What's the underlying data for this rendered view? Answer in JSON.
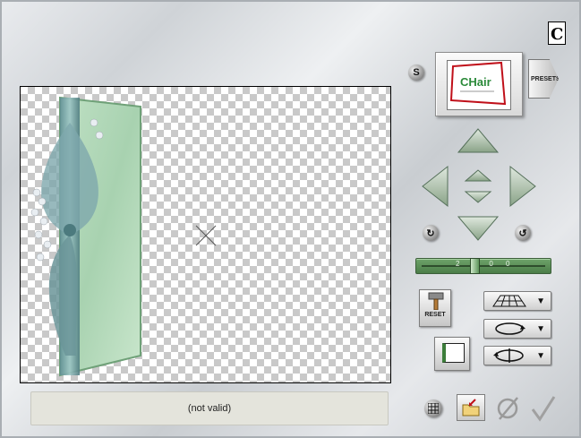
{
  "status": {
    "text": "(not valid)"
  },
  "thumbnail": {
    "caption": "CHair"
  },
  "presets": {
    "label": "PRESETS"
  },
  "s_button": {
    "label": "S"
  },
  "reset": {
    "label": "RESET"
  },
  "slider": {
    "ticks": "2 0 0 0",
    "value_fraction": 0.42
  },
  "icons": {
    "corner": "corel-logo-icon",
    "up": "arrow-up-icon",
    "down": "arrow-down-icon",
    "left": "arrow-left-icon",
    "right": "arrow-right-icon",
    "center_up": "small-arrow-up-icon",
    "center_down": "small-arrow-down-icon",
    "rotate_left": "rotate-left-icon",
    "rotate_right": "rotate-right-icon",
    "grid": "grid-icon",
    "import": "import-folder-icon",
    "cancel": "cancel-icon",
    "ok": "check-icon"
  },
  "colors": {
    "arrow_green": "#a6bea4",
    "frame_green": "#a9d3a5"
  }
}
